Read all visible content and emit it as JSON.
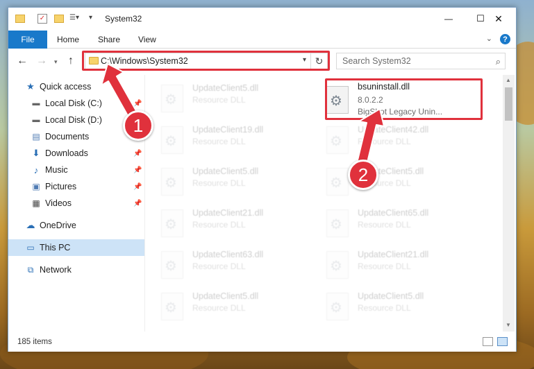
{
  "window": {
    "title": "System32",
    "controls": {
      "minimize": "—",
      "maximize": "☐",
      "close": "✕"
    }
  },
  "ribbon": {
    "file": "File",
    "tabs": [
      "Home",
      "Share",
      "View"
    ],
    "help": "?"
  },
  "nav": {
    "address": "C:\\Windows\\System32",
    "search_placeholder": "Search System32"
  },
  "sidebar": {
    "items": [
      {
        "label": "Quick access",
        "icon": "star-icon",
        "pinned": false
      },
      {
        "label": "Local Disk (C:)",
        "icon": "drive-icon",
        "pinned": true
      },
      {
        "label": "Local Disk (D:)",
        "icon": "drive-icon",
        "pinned": true
      },
      {
        "label": "Documents",
        "icon": "documents-icon",
        "pinned": true
      },
      {
        "label": "Downloads",
        "icon": "download-icon",
        "pinned": true
      },
      {
        "label": "Music",
        "icon": "music-icon",
        "pinned": true
      },
      {
        "label": "Pictures",
        "icon": "pictures-icon",
        "pinned": true
      },
      {
        "label": "Videos",
        "icon": "videos-icon",
        "pinned": true
      },
      {
        "label": "OneDrive",
        "icon": "cloud-icon",
        "pinned": false
      },
      {
        "label": "This PC",
        "icon": "pc-icon",
        "pinned": false
      },
      {
        "label": "Network",
        "icon": "network-icon",
        "pinned": false
      }
    ]
  },
  "files": {
    "highlighted": {
      "name": "bsuninstall.dll",
      "version": "8.0.2.2",
      "description": "BigShot Legacy Unin..."
    },
    "left_column": [
      {
        "name": "UpdateClient5.dll",
        "type": "Resource DLL"
      },
      {
        "name": "UpdateClient19.dll",
        "type": "Resource DLL"
      },
      {
        "name": "UpdateClient5.dll",
        "type": "Resource DLL"
      },
      {
        "name": "UpdateClient21.dll",
        "type": "Resource DLL"
      },
      {
        "name": "UpdateClient63.dll",
        "type": "Resource DLL"
      },
      {
        "name": "UpdateClient5.dll",
        "type": "Resource DLL"
      }
    ],
    "right_column": [
      {
        "name": "UpdateClient42.dll",
        "type": "Resource DLL"
      },
      {
        "name": "UpdateClient5.dll",
        "type": "Resource DLL"
      },
      {
        "name": "UpdateClient65.dll",
        "type": "Resource DLL"
      },
      {
        "name": "UpdateClient21.dll",
        "type": "Resource DLL"
      },
      {
        "name": "UpdateClient5.dll",
        "type": "Resource DLL"
      }
    ]
  },
  "status": {
    "items_count": "185 items"
  },
  "callouts": [
    "1",
    "2"
  ],
  "colors": {
    "accent": "#1979ca",
    "highlight_red": "#e0313c",
    "selected_bg": "#cde3f7"
  }
}
